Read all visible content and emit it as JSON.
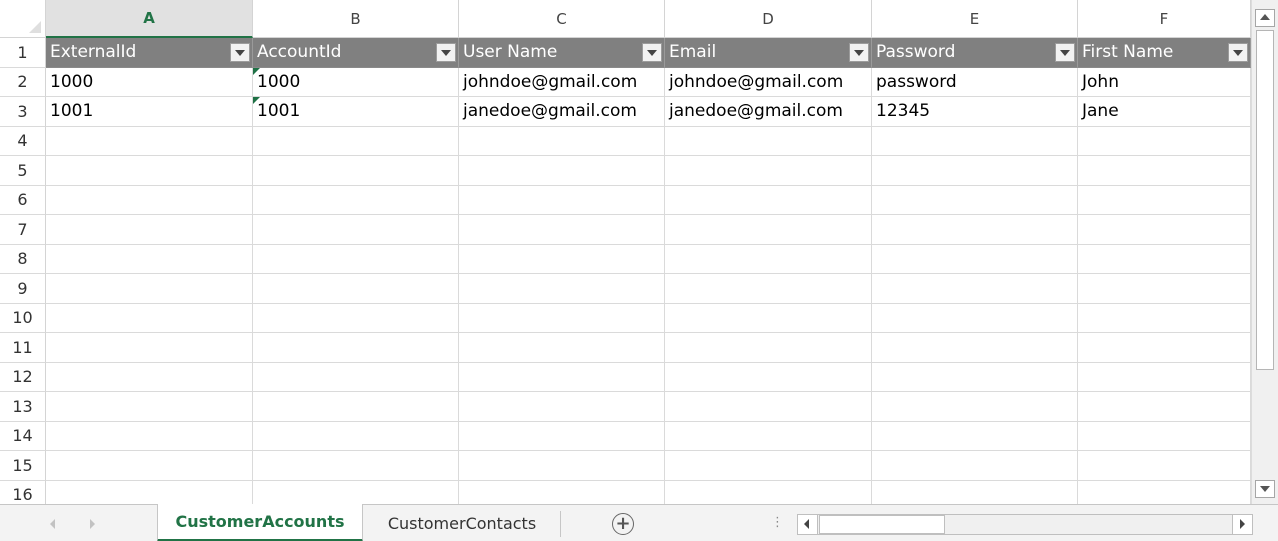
{
  "columns": [
    "A",
    "B",
    "C",
    "D",
    "E",
    "F"
  ],
  "selected_column": "A",
  "rows": [
    "1",
    "2",
    "3",
    "4",
    "5",
    "6",
    "7",
    "8",
    "9",
    "10",
    "11",
    "12",
    "13",
    "14",
    "15",
    "16"
  ],
  "table": {
    "headers": [
      "ExternalId",
      "AccountId",
      "User Name",
      "Email",
      "Password",
      "First Name"
    ],
    "data": [
      [
        "1000",
        "1000",
        "johndoe@gmail.com",
        "johndoe@gmail.com",
        "password",
        "John"
      ],
      [
        "1001",
        "1001",
        "janedoe@gmail.com",
        "janedoe@gmail.com",
        "12345",
        "Jane"
      ]
    ]
  },
  "sheets": {
    "active": "CustomerAccounts",
    "other": "CustomerContacts"
  },
  "icons": {
    "add_sheet": "plus-circle-icon",
    "filter": "filter-dropdown-icon",
    "more_dots": "ellipsis-vertical-icon"
  },
  "colors": {
    "accent": "#217346",
    "header_fill": "#808080"
  }
}
